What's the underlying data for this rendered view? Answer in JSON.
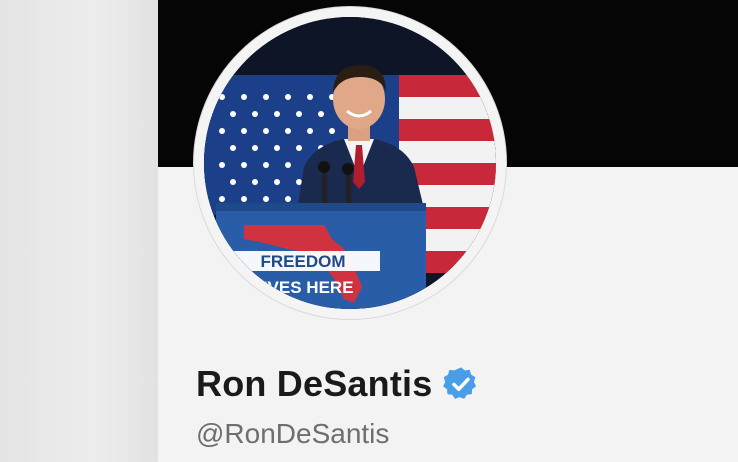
{
  "profile": {
    "display_name": "Ron DeSantis",
    "handle": "@RonDeSantis",
    "verified": true,
    "verified_badge_color": "#4a9ee8",
    "banner_color": "#050505"
  },
  "avatar": {
    "podium_sign": {
      "line1": "FREEDOM",
      "line2": "LIVES HERE"
    }
  }
}
